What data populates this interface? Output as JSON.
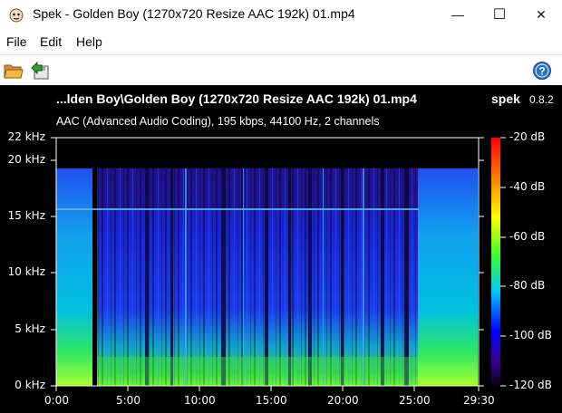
{
  "window": {
    "title": "Spek - Golden Boy (1270x720 Resize AAC 192k) 01.mp4",
    "minimize_glyph": "—",
    "maximize_glyph": "☐",
    "close_glyph": "✕"
  },
  "menu": {
    "file": "File",
    "edit": "Edit",
    "help": "Help"
  },
  "toolbar": {
    "open_icon": "folder-open-icon",
    "save_icon": "save-icon",
    "about_icon": "help-icon"
  },
  "viewer": {
    "file_title": "...lden Boy\\Golden Boy (1270x720 Resize AAC 192k) 01.mp4",
    "brand": "spek",
    "version": "0.8.2",
    "info": "AAC (Advanced Audio Coding), 195 kbps, 44100 Hz, 2 channels",
    "freq_labels": [
      "22 kHz",
      "20 kHz",
      "15 kHz",
      "10 kHz",
      "5 kHz",
      "0 kHz"
    ],
    "time_labels": [
      "0:00",
      "5:00",
      "10:00",
      "15:00",
      "20:00",
      "25:00",
      "29:30"
    ],
    "db_labels": [
      "-20 dB",
      "-40 dB",
      "-60 dB",
      "-80 dB",
      "-100 dB",
      "-120 dB"
    ]
  },
  "chart_data": {
    "type": "heatmap",
    "x_range": [
      "0:00",
      "29:30"
    ],
    "y_range_khz": [
      0,
      22
    ],
    "color_range_db": [
      -120,
      -20
    ],
    "frequency_cutoff_khz": 19,
    "colors": {
      "hot": "#ff0000",
      "warm": "#ffff00",
      "mid": "#00ff66",
      "cool": "#0000ff",
      "cold": "#10003a"
    }
  }
}
